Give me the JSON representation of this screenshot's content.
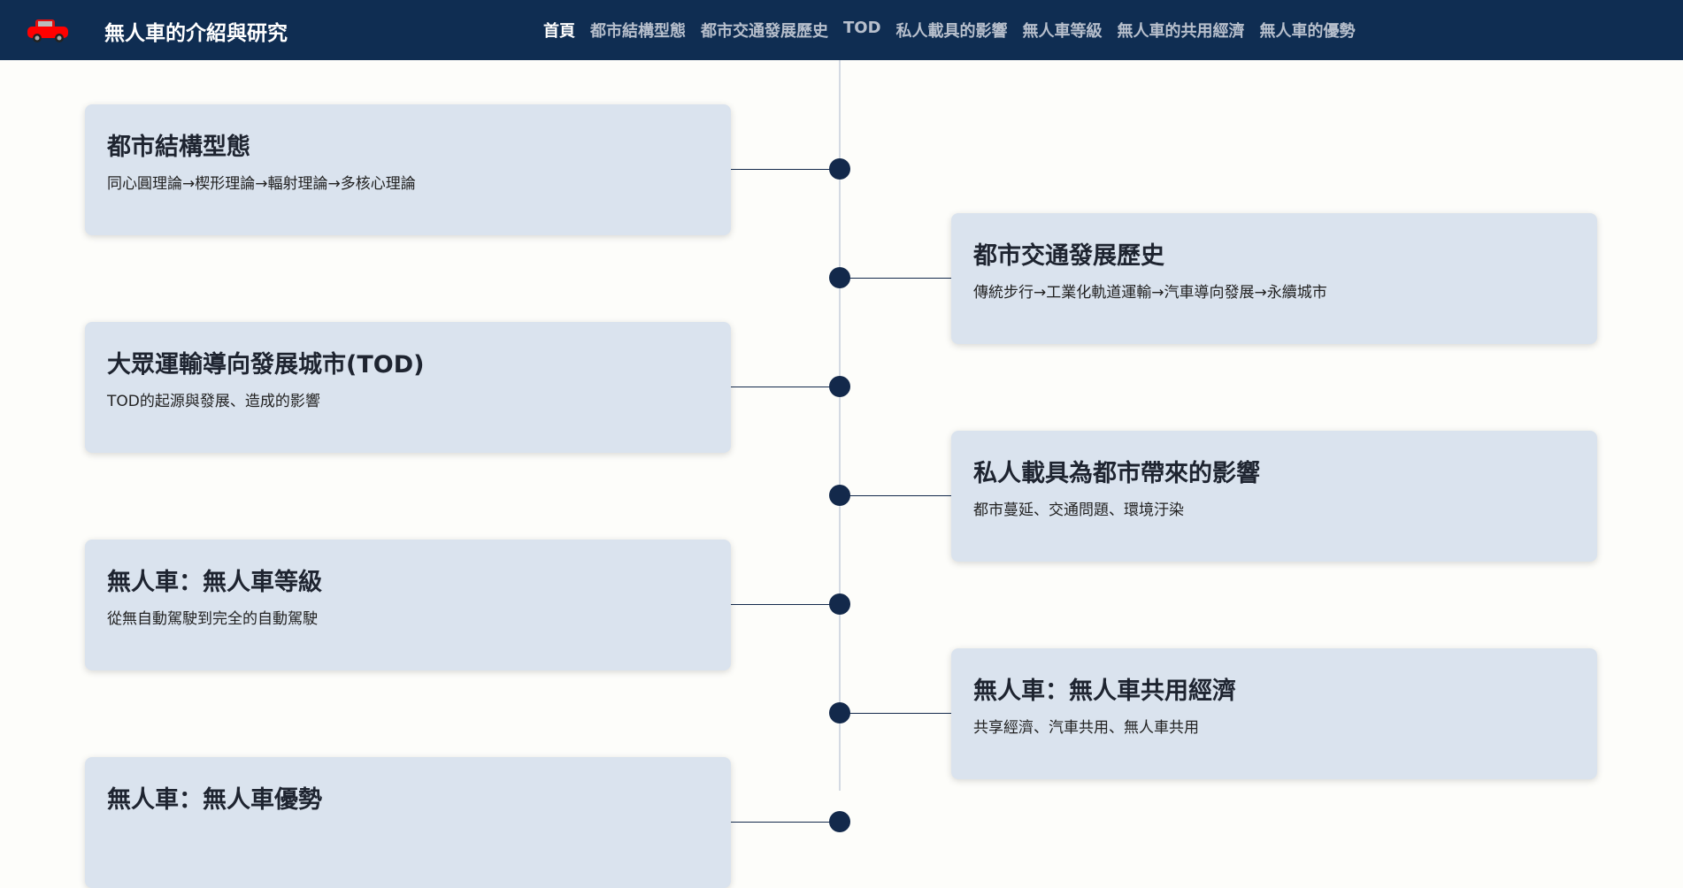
{
  "header": {
    "title": "無人車的介紹與研究",
    "logo_icon": "car-icon",
    "links": [
      "首頁",
      "都市結構型態",
      "都市交通發展歷史",
      "TOD",
      "私人載具的影響",
      "無人車等級",
      "無人車的共用經濟",
      "無人車的優勢"
    ],
    "active_index": 0
  },
  "timeline": [
    {
      "title": "都市結構型態",
      "desc": "同心圓理論→楔形理論→輻射理論→多核心理論"
    },
    {
      "title": "都市交通發展歷史",
      "desc": "傳統步行→工業化軌道運輸→汽車導向發展→永續城市"
    },
    {
      "title": "大眾運輸導向發展城市(TOD)",
      "desc": "TOD的起源與發展、造成的影響"
    },
    {
      "title": "私人載具為都市帶來的影響",
      "desc": "都市蔓延、交通問題、環境汙染"
    },
    {
      "title": "無人車：無人車等級",
      "desc": "從無自動駕駛到完全的自動駕駛"
    },
    {
      "title": "無人車：無人車共用經濟",
      "desc": "共享經濟、汽車共用、無人車共用"
    },
    {
      "title": "無人車：無人車優勢",
      "desc": ""
    }
  ]
}
